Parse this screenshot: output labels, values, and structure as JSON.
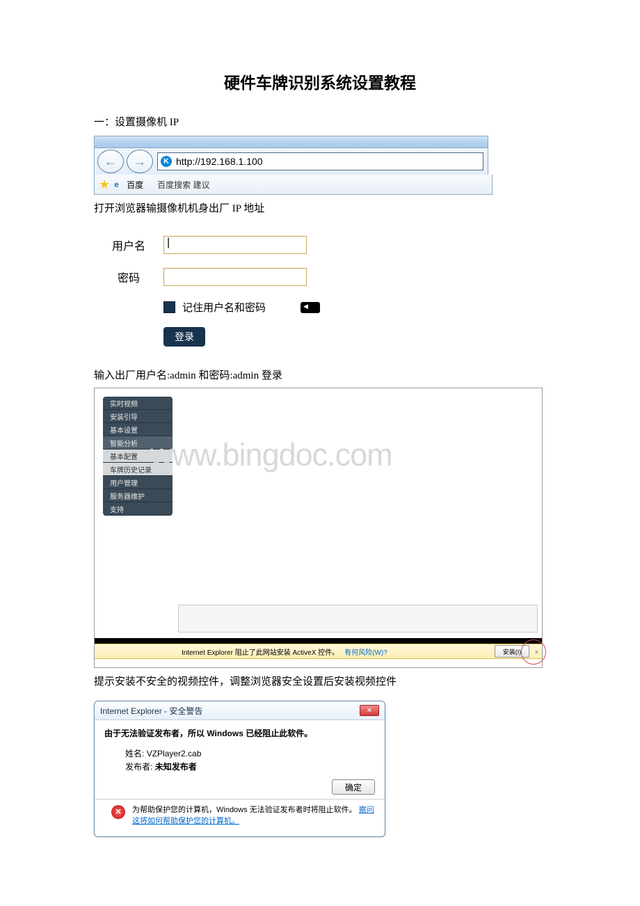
{
  "title": "硬件车牌识别系统设置教程",
  "section1": "一：设置摄像机 IP",
  "browser": {
    "url": "http://192.168.1.100",
    "fav_label": "百度",
    "suggest": "百度搜索 建议"
  },
  "text_open_browser": "打开浏览器输摄像机机身出厂 IP 地址",
  "login": {
    "user_label": "用户名",
    "pass_label": "密码",
    "remember": "记住用户名和密码",
    "login_btn": "登录"
  },
  "text_enter_creds": "输入出厂用户名:admin 和密码:admin  登录",
  "menu": {
    "items": [
      "实时视频",
      "安装引导",
      "基本设置",
      "智能分析",
      "基本配置",
      "车牌历史记录",
      "用户管理",
      "服务器维护",
      "支持"
    ]
  },
  "watermark": "www.bingdoc.com",
  "activex": {
    "msg": "Internet Explorer 阻止了此网站安装 ActiveX 控件。",
    "risk": "有何风险(W)?",
    "install": "安装(I)"
  },
  "text_activex": "提示安装不安全的视频控件，调整浏览器安全设置后安装视频控件",
  "dialog": {
    "title": "Internet Explorer  -  安全警告",
    "header": "由于无法验证发布者，所以 Windows 已经阻止此软件。",
    "name_label": "姓名:",
    "name_value": "VZPlayer2.cab",
    "pub_label": "发布者:",
    "pub_value": "未知发布者",
    "ok": "确定",
    "footer_text": "为帮助保护您的计算机，Windows 无法验证发布者时将阻止软件。",
    "footer_link": "察问这将如何帮助保护您的计算机。"
  }
}
